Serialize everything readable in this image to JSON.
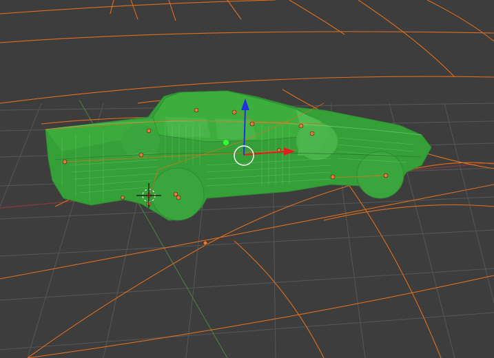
{
  "app": "3D viewport",
  "viewport": {
    "background_color": "#3d3d3d",
    "grid_color": "#5a5a5a",
    "lattice_color": "#e07020",
    "x_axis_color": "#9a3a3a",
    "y_axis_color": "#4a7a3a"
  },
  "model": {
    "name": "car",
    "display": "wireframe",
    "selected": true,
    "color": "#38a038",
    "wire_color": "#70d070"
  },
  "gizmo": {
    "x_color": "#e02020",
    "z_color": "#2030e0",
    "ring_color": "#ffffff",
    "origin_color": "#30ff30"
  },
  "cursor_3d": {
    "present": true
  },
  "control_points": {
    "color": "#e07a3a",
    "count": 17
  }
}
